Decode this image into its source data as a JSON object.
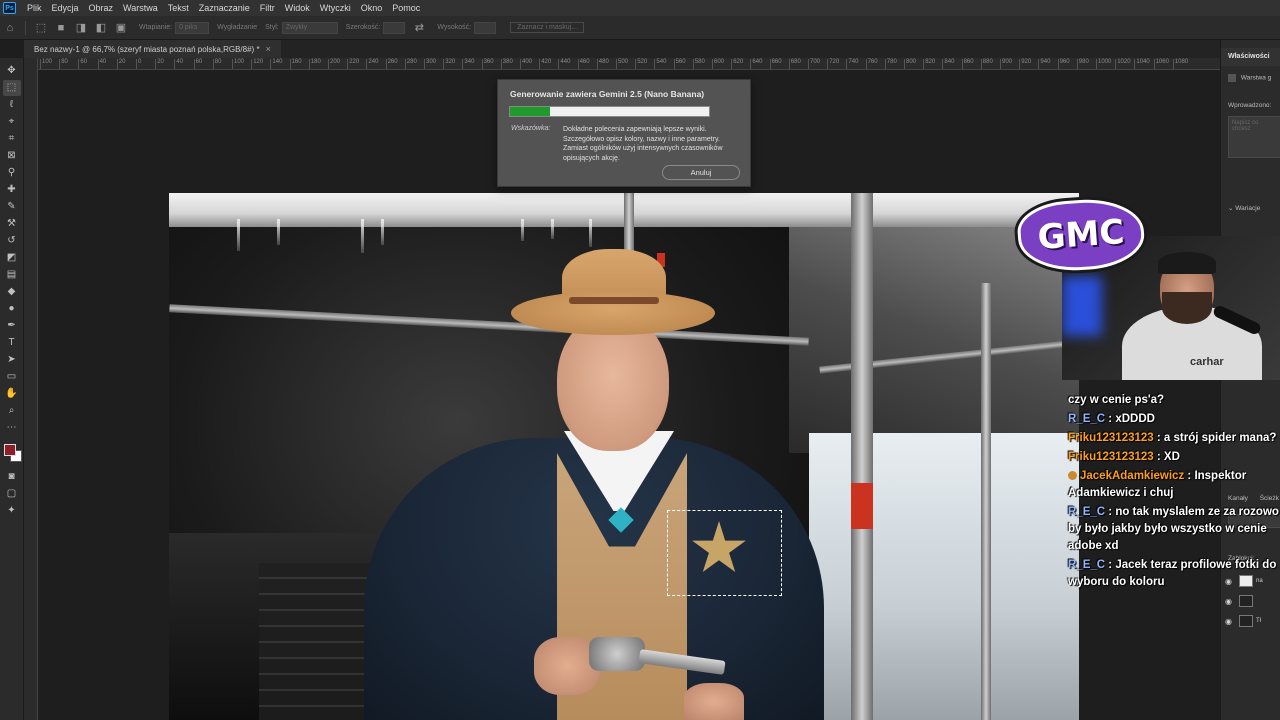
{
  "app": {
    "logo_text": "Ps",
    "menu": [
      "Plik",
      "Edycja",
      "Obraz",
      "Warstwa",
      "Tekst",
      "Zaznaczanie",
      "Filtr",
      "Widok",
      "Wtyczki",
      "Okno",
      "Pomoc"
    ]
  },
  "options_bar": {
    "feather_label": "Wtapianie:",
    "feather_value": "0 piks",
    "antialias_label": "Wygładzanie",
    "style_label": "Styl:",
    "style_value": "Zwykły",
    "width_label": "Szerokość:",
    "height_label": "Wysokość:",
    "select_mask_label": "Zaznacz i maskuj..."
  },
  "document": {
    "tab_title": "Bez nazwy-1 @ 66,7% (szeryf miasta poznań polska,RGB/8#) *",
    "close_glyph": "×"
  },
  "ruler": {
    "ticks": [
      "100",
      "80",
      "60",
      "40",
      "20",
      "0",
      "20",
      "40",
      "60",
      "80",
      "100",
      "120",
      "140",
      "160",
      "180",
      "200",
      "220",
      "240",
      "260",
      "280",
      "300",
      "320",
      "340",
      "360",
      "380",
      "400",
      "420",
      "440",
      "460",
      "480",
      "500",
      "520",
      "540",
      "560",
      "580",
      "600",
      "620",
      "640",
      "660",
      "680",
      "700",
      "720",
      "740",
      "760",
      "780",
      "800",
      "820",
      "840",
      "860",
      "880",
      "900",
      "920",
      "940",
      "960",
      "980",
      "1000",
      "1020",
      "1040",
      "1060",
      "1080"
    ]
  },
  "progress_dialog": {
    "title": "Generowanie zawiera Gemini 2.5 (Nano Banana)",
    "progress_fraction": 0.2,
    "hint_label": "Wskazówka:",
    "hint_text": "Dokładne polecenia zapewniają lepsze wyniki. Szczegółowo opisz kolory, nazwy i inne parametry. Zamiast ogólników użyj intensywnych czasowników opisujących akcję.",
    "cancel_label": "Anuluj"
  },
  "right_panel": {
    "properties_tab": "Właściwości",
    "layer_item": "Warstwa g",
    "prompt_label": "Wprowadzono:",
    "prompt_placeholder": "Napisz co chcesz",
    "variations_label": "Wariacje",
    "channels_tab": "Kanały",
    "paths_tab": "Ścieżk",
    "lock_label": "Zablokuj:",
    "layer_names": [
      "na",
      "",
      "Tł"
    ]
  },
  "stream_overlay": {
    "logo_text": "GMC",
    "webcam_shirt_text": "carhar",
    "chat": [
      {
        "user": "",
        "message": "czy w cenie ps'a?",
        "style": "plain"
      },
      {
        "user": "R_E_C",
        "message": "xDDDD",
        "style": "rec"
      },
      {
        "user": "Friku123123123",
        "message": "a strój spider mana?",
        "style": "orange"
      },
      {
        "user": "Friku123123123",
        "message": "XD",
        "style": "orange"
      },
      {
        "user": "JacekAdamkiewicz",
        "message": "Inspektor Adamkiewicz i chuj",
        "style": "orange",
        "badge": true
      },
      {
        "user": "R_E_C",
        "message": "no tak myslalem ze za rozowo by było jakby było wszystko w cenie adobe xd",
        "style": "rec"
      },
      {
        "user": "R_E_C",
        "message": "Jacek teraz profilowe fotki do wyboru do koloru",
        "style": "rec"
      }
    ]
  },
  "colors": {
    "foreground_swatch": "#8c1f2a",
    "background_swatch": "#ffffff",
    "progress_green": "#1e9b2a",
    "gmc_purple": "#7b3fc4"
  }
}
